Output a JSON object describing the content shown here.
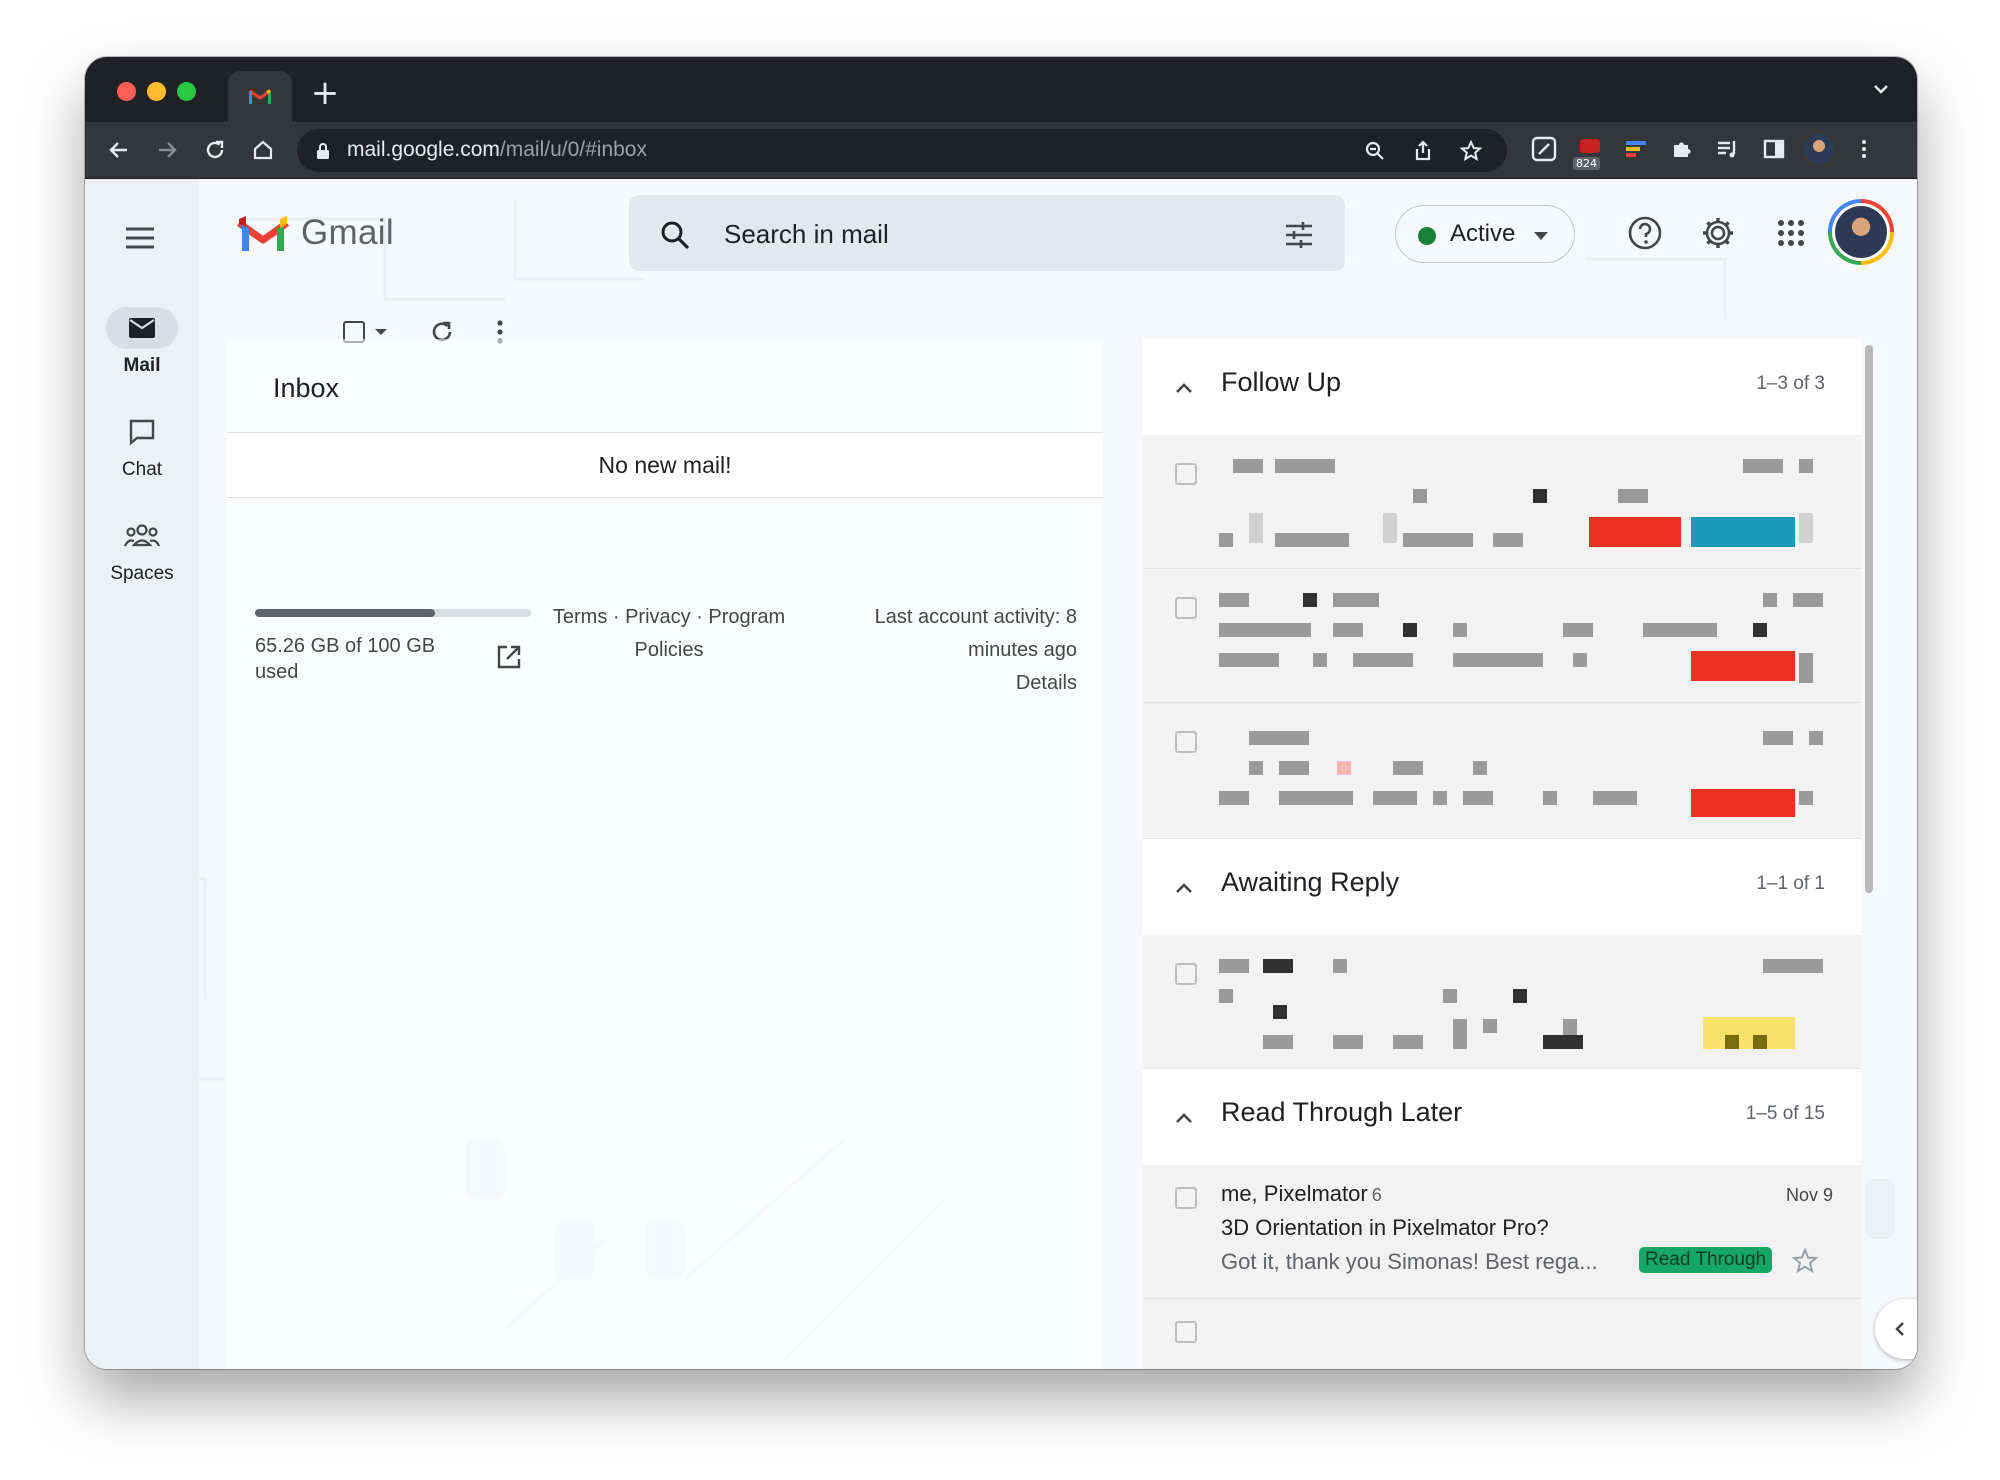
{
  "browser": {
    "url_host": "mail.google.com",
    "url_path": "/mail/u/0/#inbox",
    "extension_badge": "824"
  },
  "header": {
    "app_name": "Gmail",
    "search_placeholder": "Search in mail",
    "status_label": "Active"
  },
  "rail": {
    "items": [
      {
        "label": "Mail"
      },
      {
        "label": "Chat"
      },
      {
        "label": "Spaces"
      }
    ]
  },
  "inbox": {
    "title": "Inbox",
    "empty_message": "No new mail!",
    "storage_text": "65.26 GB of 100 GB used",
    "storage_fraction": 0.6526,
    "footer_links": "Terms · Privacy · Program Policies",
    "activity_text": "Last account activity: 8 minutes ago",
    "details_link": "Details"
  },
  "sections": [
    {
      "title": "Follow Up",
      "count": "1–3 of 3"
    },
    {
      "title": "Awaiting Reply",
      "count": "1–1 of 1"
    },
    {
      "title": "Read Through Later",
      "count": "1–5 of 15"
    }
  ],
  "read_later_row": {
    "sender": "me, Pixelmator",
    "thread_count": "6",
    "date": "Nov 9",
    "subject": "3D Orientation in Pixelmator Pro?",
    "snippet": "Got it, thank you Simonas! Best rega...",
    "label": "Read Through",
    "label_color": "#16a765"
  },
  "colors": {
    "status_active": "#188038",
    "label_red": "#ea3323",
    "label_teal": "#1a9bb8",
    "label_yellow": "#f8e26a"
  }
}
